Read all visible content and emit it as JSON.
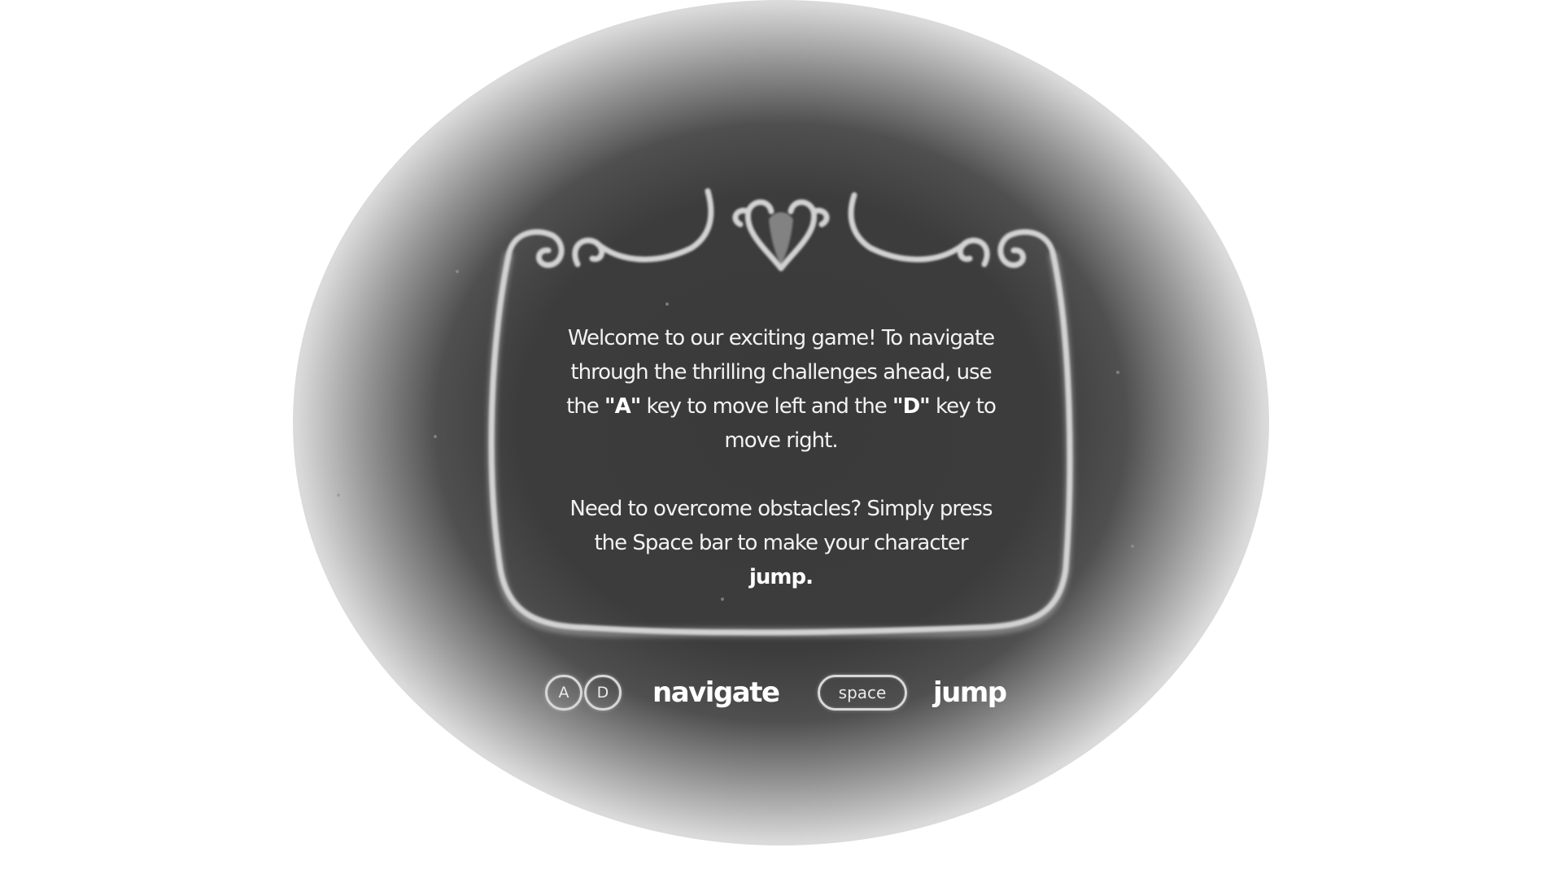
{
  "dialog": {
    "paragraph1": {
      "part1": "Welcome to our exciting game! To navigate through the thrilling challenges ahead, use the ",
      "key_a": "\"A\"",
      "part2": " key to move left and the ",
      "key_d": "\"D\"",
      "part3": " key to move right."
    },
    "paragraph2": {
      "part1": "Need to overcome obstacles? Simply press the Space bar to make your character ",
      "emphasis": "jump."
    }
  },
  "controls": {
    "navigate": {
      "keys": [
        "A",
        "D"
      ],
      "label": "navigate"
    },
    "jump": {
      "key": "space",
      "label": "jump"
    }
  },
  "colors": {
    "panel": "#3a3a3a",
    "frame": "#cfcfcf",
    "text": "#f2f2f2",
    "page": "#ffffff"
  },
  "icons": {
    "frame": "ornate-chalk-frame"
  }
}
